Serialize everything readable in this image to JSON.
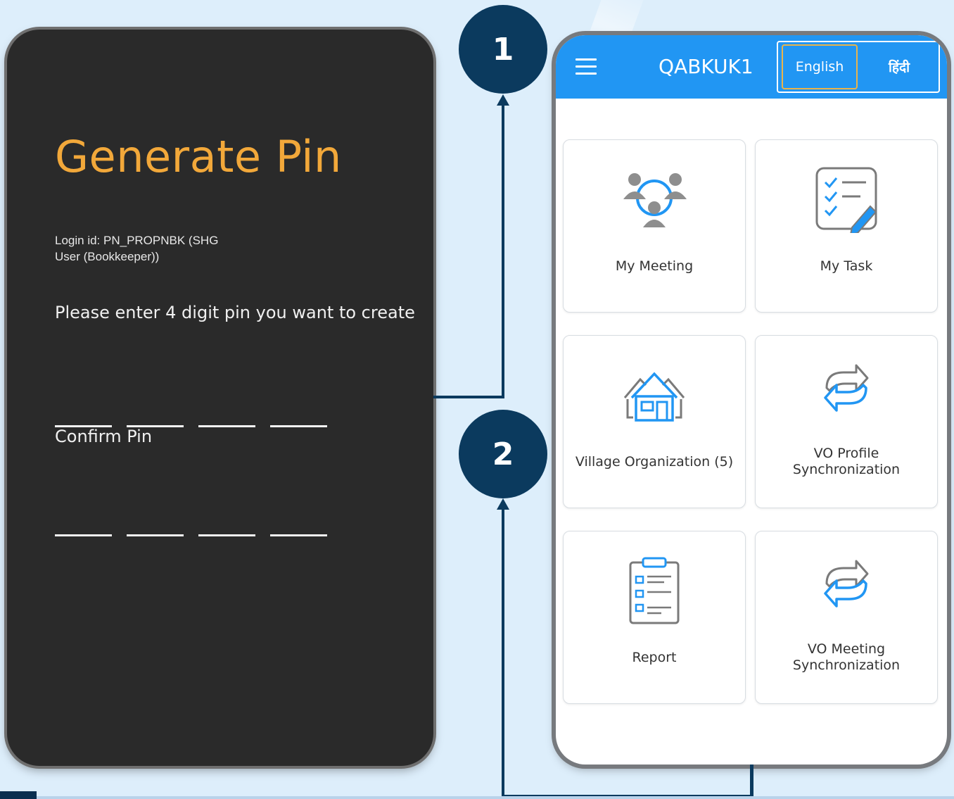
{
  "left_screen": {
    "title": "Generate Pin",
    "login_id_line1": "Login id: PN_PROPNBK (SHG",
    "login_id_line2": "User (Bookkeeper))",
    "prompt": "Please enter 4 digit pin you want to create",
    "confirm_label": "Confirm Pin"
  },
  "right_screen": {
    "app_title": "QABKUK1",
    "lang_english": "English",
    "lang_hindi": "हिंदी",
    "tiles": [
      {
        "label": "My Meeting",
        "icon": "meeting-icon"
      },
      {
        "label": "My Task",
        "icon": "task-checklist-icon"
      },
      {
        "label": "Village Organization (5)",
        "icon": "village-house-icon"
      },
      {
        "label_line1": "VO Profile",
        "label_line2": "Synchronization",
        "icon": "sync-icon"
      },
      {
        "label": "Report",
        "icon": "report-clipboard-icon"
      },
      {
        "label_line1": "VO Meeting",
        "label_line2": "Synchronization",
        "icon": "sync-icon"
      }
    ]
  },
  "steps": {
    "step1": "1",
    "step2": "2"
  },
  "colors": {
    "background": "#ddeefb",
    "accent_blue": "#2196f3",
    "title_orange": "#f2a83a",
    "step_navy": "#0b3a5e",
    "dark_screen": "#2a2a2a"
  }
}
